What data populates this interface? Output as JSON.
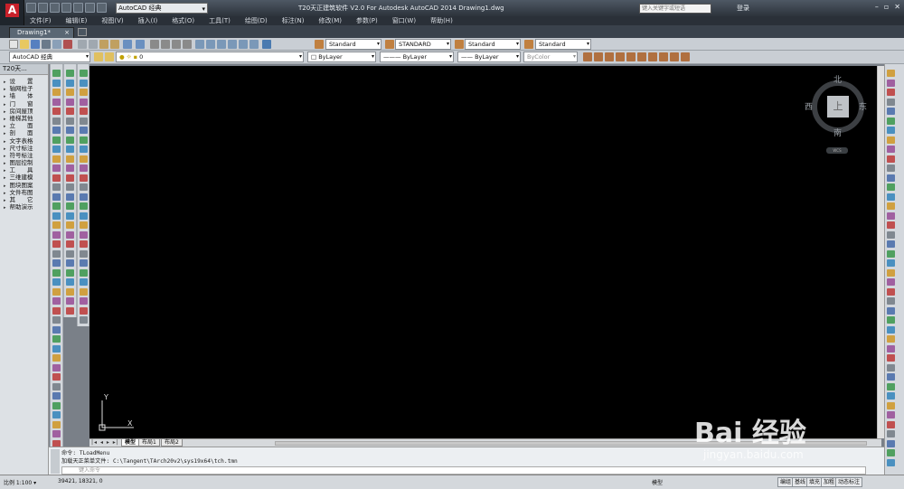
{
  "window": {
    "title": "T20天正建筑软件 V2.0 For Autodesk AutoCAD 2014    Drawing1.dwg",
    "search_placeholder": "键入关键字或短语",
    "login": "登录",
    "controls": [
      "–",
      "▫",
      "✕"
    ]
  },
  "workspace": {
    "selected": "AutoCAD 经典"
  },
  "menu": [
    "文件(F)",
    "编辑(E)",
    "视图(V)",
    "插入(I)",
    "格式(O)",
    "工具(T)",
    "绘图(D)",
    "标注(N)",
    "修改(M)",
    "参数(P)",
    "窗口(W)",
    "帮助(H)"
  ],
  "doc_tab": {
    "label": "Drawing1*",
    "close": "×"
  },
  "toolbar": {
    "workspace_combo": "AutoCAD 经典",
    "text_style": "Standard",
    "dim_style": "STANDARD",
    "table_style": "Standard",
    "multileader_style": "Standard",
    "layer": "0",
    "color": "ByLayer",
    "linetype": "ByLayer",
    "lineweight": "ByLayer",
    "plotstyle": "ByColor"
  },
  "tangent_panel": {
    "title": "T20天...",
    "items": [
      "设　　置",
      "轴网柱子",
      "墙　　体",
      "门　　窗",
      "房间屋顶",
      "楼梯其他",
      "立　　面",
      "剖　　面",
      "文字表格",
      "尺寸标注",
      "符号标注",
      "图层控制",
      "工　　具",
      "三维建模",
      "图块图案",
      "文件布图",
      "其　　它",
      "帮助演示"
    ]
  },
  "viewcube": {
    "north": "北",
    "south": "南",
    "east": "东",
    "west": "西",
    "top": "上",
    "wcs": "WCS"
  },
  "ucs": {
    "x": "X",
    "y": "Y"
  },
  "layout_tabs": {
    "nav": "|◂ ◂ ▸ ▸|",
    "tabs": [
      "模型",
      "布局1",
      "布局2"
    ]
  },
  "command": {
    "lines": [
      "命令: TLoadMenu",
      "加载天正菜单文件: C:\\Tangent\\TArch20v2\\sys19x64\\tch.tmn"
    ],
    "placeholder": "键入命令"
  },
  "status": {
    "scale": "比例 1:100 ▾",
    "coords": "39421, 18321, 0",
    "model": "模型",
    "buttons": [
      "编组",
      "基线",
      "填充",
      "加粗",
      "动态标注"
    ]
  },
  "watermark": {
    "text": "Bai 经验",
    "sub": "jingyan.baidu.com"
  },
  "colors": {
    "canvas": "#000000",
    "accent": "#c8202a"
  }
}
